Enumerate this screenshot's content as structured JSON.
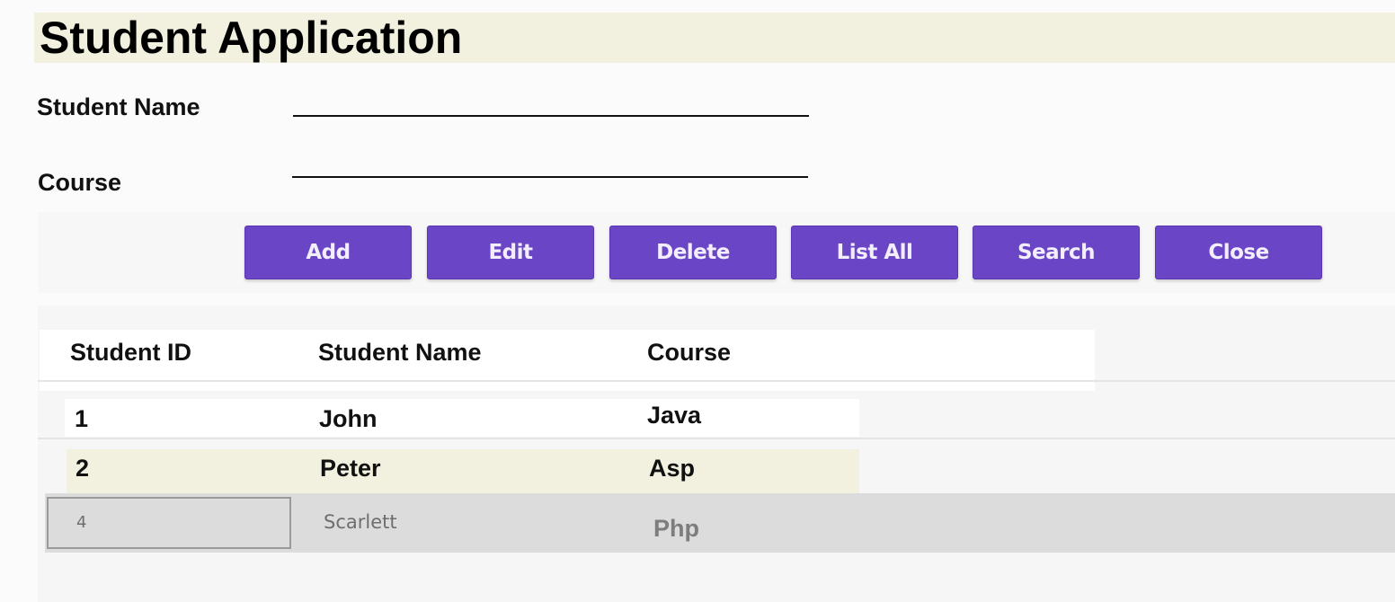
{
  "title": "Student Application",
  "form": {
    "student_name_label": "Student Name",
    "student_name_value": "",
    "course_label": "Course",
    "course_value": ""
  },
  "buttons": {
    "add": "Add",
    "edit": "Edit",
    "delete": "Delete",
    "list_all": "List All",
    "search": "Search",
    "close": "Close"
  },
  "table": {
    "headers": [
      "Student ID",
      "Student Name",
      "Course"
    ],
    "rows": [
      {
        "id": "1",
        "name": "John",
        "course": "Java"
      },
      {
        "id": "2",
        "name": "Peter",
        "course": "Asp"
      },
      {
        "id": "4",
        "name": "Scarlett",
        "course": "Php"
      }
    ]
  },
  "colors": {
    "accent_button": "#6a45c6",
    "title_highlight": "#f2f0de",
    "selected_row": "#dcdcdc"
  }
}
